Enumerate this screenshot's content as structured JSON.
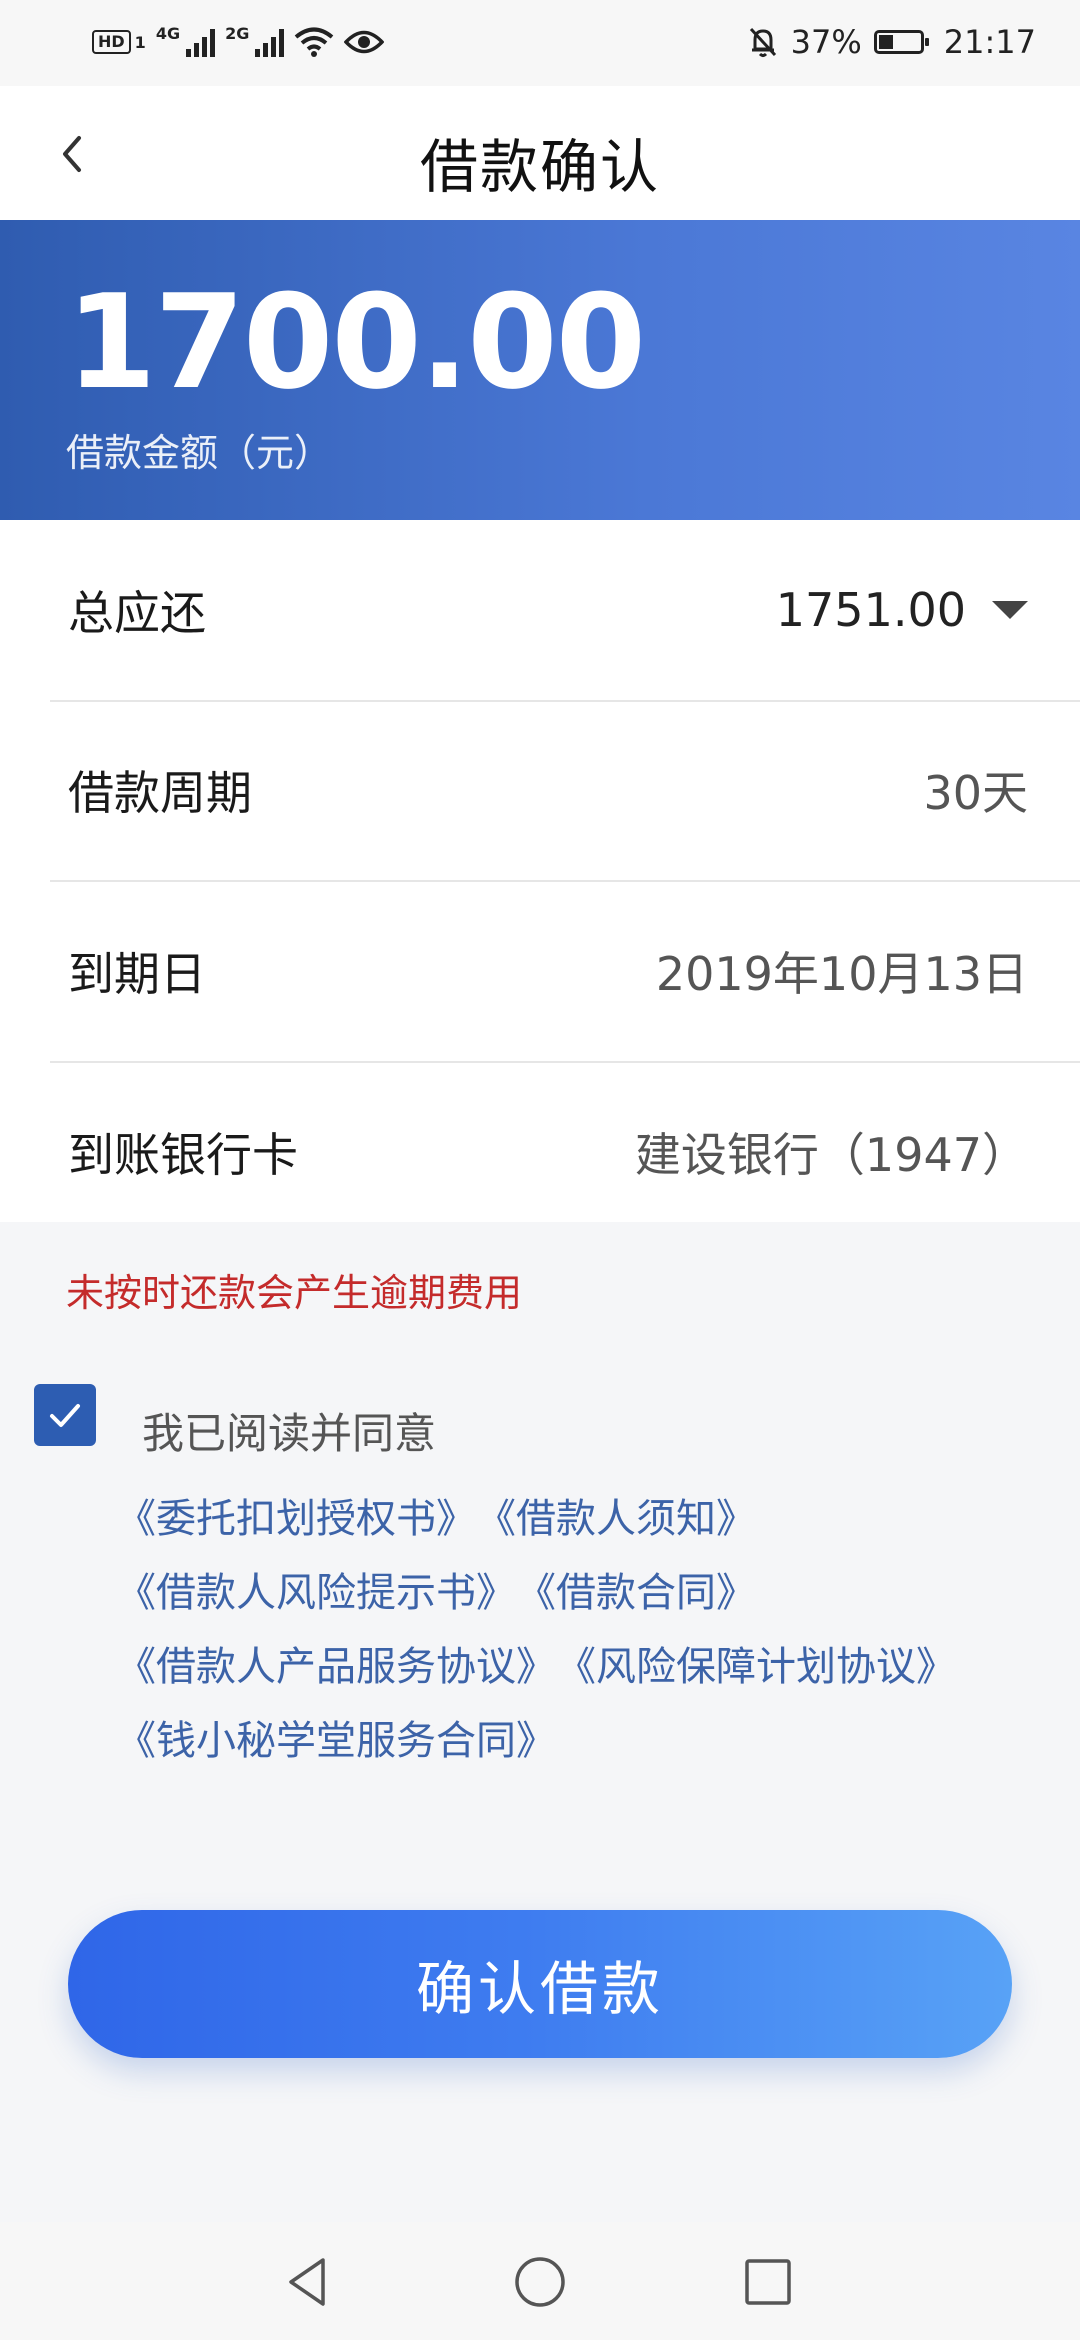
{
  "status_bar": {
    "hd_label": "HD",
    "sim1": "1",
    "net1": "4G",
    "net2": "2G",
    "battery": "37%",
    "time": "21:17"
  },
  "header": {
    "title": "借款确认"
  },
  "hero": {
    "amount": "1700.00",
    "label": "借款金额（元）"
  },
  "details": [
    {
      "label": "总应还",
      "value": "1751.00"
    },
    {
      "label": "借款周期",
      "value": "30天"
    },
    {
      "label": "到期日",
      "value": "2019年10月13日"
    },
    {
      "label": "到账银行卡",
      "value": "建设银行（1947）"
    }
  ],
  "warning": "未按时还款会产生逾期费用",
  "agreement": {
    "text": "我已阅读并同意",
    "checked": true,
    "docs": [
      "《委托扣划授权书》",
      "《借款人须知》",
      "《借款人风险提示书》",
      "《借款合同》",
      "《借款人产品服务协议》",
      "《风险保障计划协议》",
      "《钱小秘学堂服务合同》"
    ]
  },
  "confirm_button": "确认借款",
  "colors": {
    "accent": "#2f5cb0",
    "link": "#3c63a8",
    "warning": "#c42b2b",
    "button_start": "#2f66e8",
    "button_end": "#58a2f6"
  },
  "icons": {
    "back": "chevron-left-icon",
    "dropdown": "caret-down-icon",
    "check": "checkmark-icon",
    "nav_back": "triangle-back-icon",
    "nav_home": "circle-home-icon",
    "nav_recents": "square-recents-icon"
  }
}
